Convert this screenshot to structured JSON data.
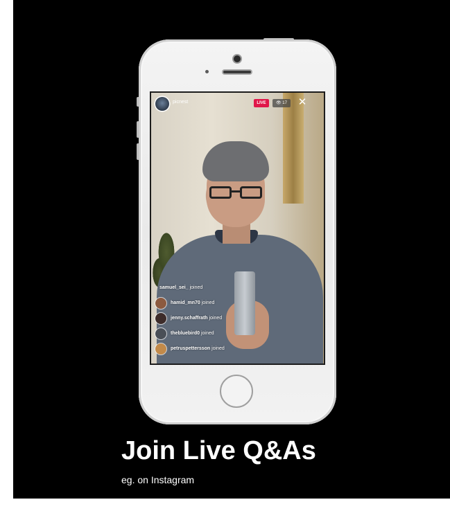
{
  "slide": {
    "headline": "Join Live Q&As",
    "subline": "eg. on Instagram"
  },
  "live": {
    "host_name": "picnest",
    "live_badge": "LIVE",
    "viewer_count": "👁 17",
    "close_glyph": "✕",
    "feed": [
      {
        "username": "samuel_sei_",
        "action": " joined",
        "avatar": "none",
        "color": "#000000"
      },
      {
        "username": "hamid_mn70",
        "action": " joined",
        "avatar": "user-avatar",
        "color": "#8c5a3f"
      },
      {
        "username": "jenny.schaffrath",
        "action": " joined",
        "avatar": "user-avatar",
        "color": "#3d2c2a"
      },
      {
        "username": "thebluebird0",
        "action": " joined",
        "avatar": "user-avatar",
        "color": "#4a4f57"
      },
      {
        "username": "petruspettersson",
        "action": " joined",
        "avatar": "user-avatar",
        "color": "#c28a4a"
      }
    ]
  },
  "icons": {
    "close": "close-icon",
    "eye": "eye-icon"
  },
  "colors": {
    "background": "#000000",
    "live_badge": "#e0174a",
    "phone_body": "#f0f0f0"
  }
}
